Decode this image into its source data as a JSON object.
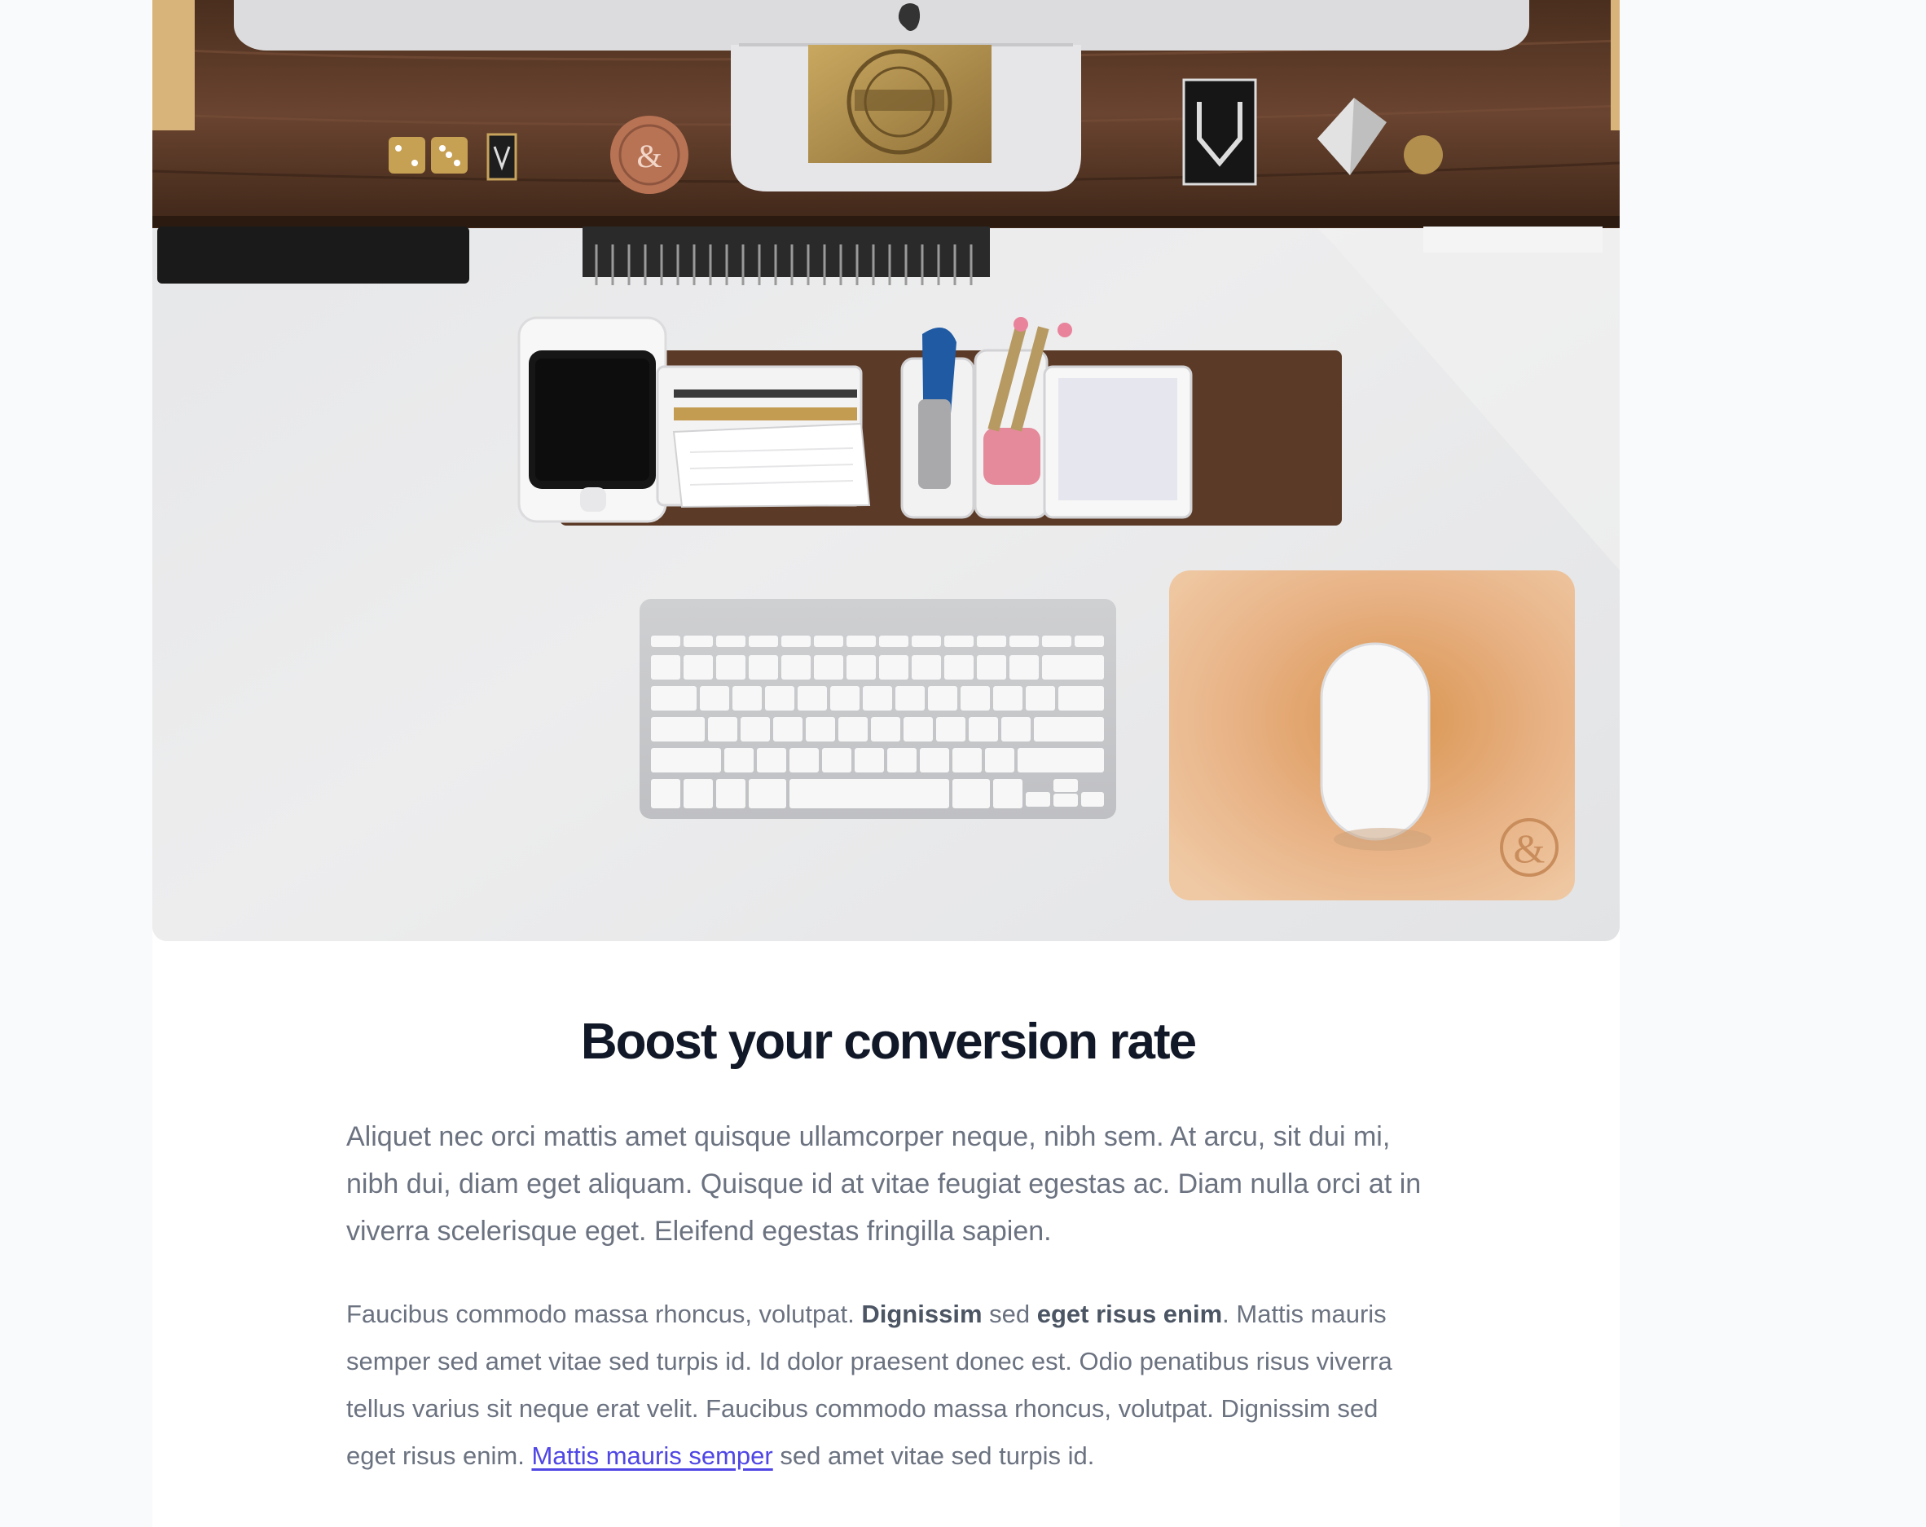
{
  "article": {
    "title": "Boost your conversion rate",
    "lead": "Aliquet nec orci mattis amet quisque ullamcorper neque, nibh sem. At arcu, sit dui mi, nibh dui, diam eget aliquam. Quisque id at vitae feugiat egestas ac. Diam nulla orci at in viverra scelerisque eget. Eleifend egestas fringilla sapien.",
    "paragraph": {
      "part1": "Faucibus commodo massa rhoncus, volutpat. ",
      "bold1": "Dignissim",
      "part2": " sed ",
      "bold2": "eget risus enim",
      "part3": ". Mattis mauris semper sed amet vitae sed turpis id. Id dolor praesent donec est. Odio penatibus risus viverra tellus varius sit neque erat velit. Faucibus commodo massa rhoncus, volutpat. Dignissim sed eget risus enim. ",
      "link": "Mattis mauris semper",
      "part4": " sed amet vitae sed turpis id."
    }
  },
  "hero_image": {
    "icon": "desk-workspace-photo",
    "colors": {
      "desk": "#e8e9eb",
      "shelf": "#5a3a26",
      "leather": "#e0a978",
      "brass": "#b8964f"
    }
  }
}
